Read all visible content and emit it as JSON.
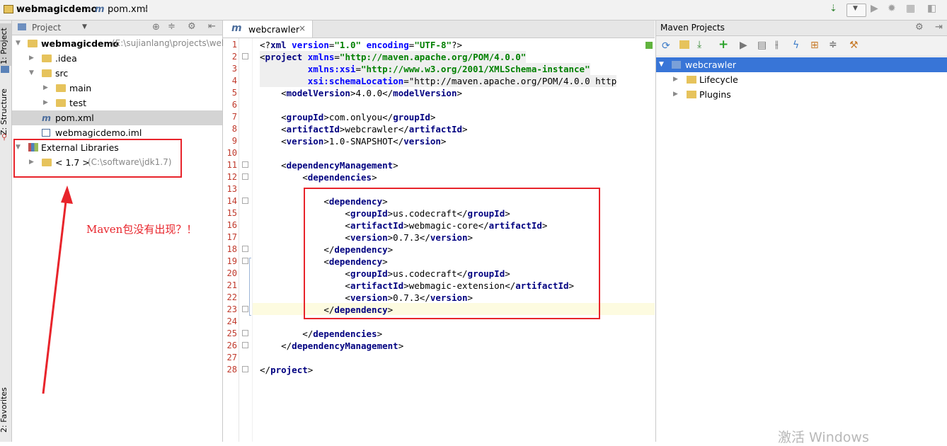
{
  "navbar": {
    "project": "webmagicdemo",
    "file": "pom.xml"
  },
  "stripe": {
    "project_tab": "1: Project",
    "structure_tab": "Z: Structure",
    "favorites_tab": "2: Favorites"
  },
  "project_panel": {
    "dropdown": "Project",
    "root_name": "webmagicdemo",
    "root_path": "(E:\\sujianlang\\projects\\web",
    "items": [
      {
        "label": "webmagicdemo"
      },
      {
        "label": ".idea"
      },
      {
        "label": "src"
      },
      {
        "label": "main"
      },
      {
        "label": "test"
      },
      {
        "label": "pom.xml"
      },
      {
        "label": "webmagicdemo.iml"
      },
      {
        "label": "External Libraries"
      },
      {
        "label": "< 1.7 >"
      }
    ],
    "jdk_path": "(C:\\software\\jdk1.7)",
    "annotation": "Maven包没有出现？！"
  },
  "editor": {
    "tab_label": "webcrawler",
    "lines": [
      "<?xml version=\"1.0\" encoding=\"UTF-8\"?>",
      "<project xmlns=\"http://maven.apache.org/POM/4.0.0\"",
      "         xmlns:xsi=\"http://www.w3.org/2001/XMLSchema-instance\"",
      "         xsi:schemaLocation=\"http://maven.apache.org/POM/4.0.0 http",
      "    <modelVersion>4.0.0</modelVersion>",
      "",
      "    <groupId>com.onlyou</groupId>",
      "    <artifactId>webcrawler</artifactId>",
      "    <version>1.0-SNAPSHOT</version>",
      "",
      "    <dependencyManagement>",
      "        <dependencies>",
      "",
      "            <dependency>",
      "                <groupId>us.codecraft</groupId>",
      "                <artifactId>webmagic-core</artifactId>",
      "                <version>0.7.3</version>",
      "            </dependency>",
      "            <dependency>",
      "                <groupId>us.codecraft</groupId>",
      "                <artifactId>webmagic-extension</artifactId>",
      "                <version>0.7.3</version>",
      "            </dependency>",
      "",
      "        </dependencies>",
      "    </dependencyManagement>",
      "",
      "</project>"
    ],
    "line_numbers": [
      "1",
      "2",
      "3",
      "4",
      "5",
      "6",
      "7",
      "8",
      "9",
      "10",
      "11",
      "12",
      "13",
      "14",
      "15",
      "16",
      "17",
      "18",
      "19",
      "20",
      "21",
      "22",
      "23",
      "24",
      "25",
      "26",
      "27",
      "28"
    ]
  },
  "maven_panel": {
    "title": "Maven Projects",
    "items": [
      {
        "label": "webcrawler"
      },
      {
        "label": "Lifecycle"
      },
      {
        "label": "Plugins"
      }
    ]
  },
  "watermark": "激活 Windows",
  "colors": {
    "selection_blue": "#3875d7",
    "annotation_red": "#e8242b",
    "xml_tag": "#000080",
    "xml_string": "#008000",
    "xml_attr": "#0000ff"
  }
}
